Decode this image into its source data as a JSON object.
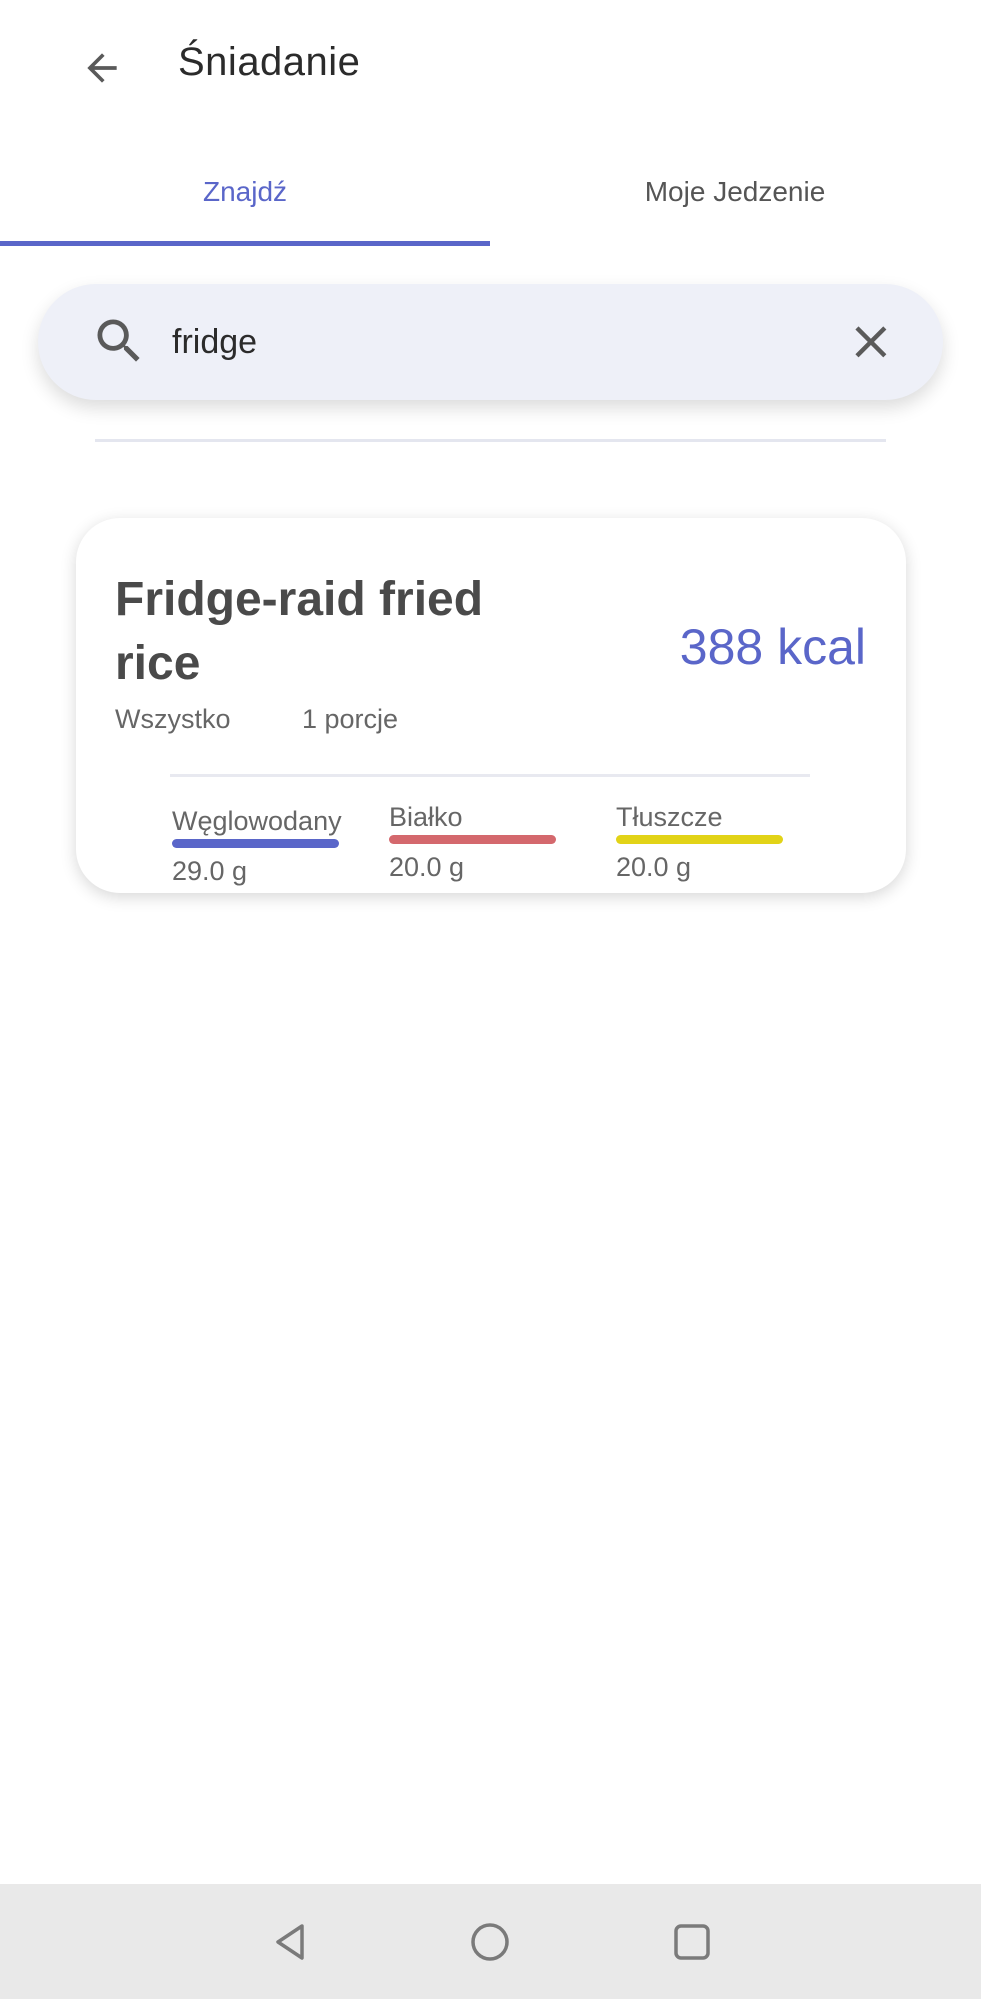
{
  "header": {
    "title": "Śniadanie",
    "back_icon": "arrow-left-icon"
  },
  "tabs": [
    {
      "label": "Znajdź",
      "active": true
    },
    {
      "label": "Moje Jedzenie",
      "active": false
    }
  ],
  "search": {
    "value": "fridge",
    "icon": "search-icon",
    "clear_icon": "close-icon"
  },
  "results": [
    {
      "name": "Fridge-raid fried rice",
      "kcal": "388 kcal",
      "category": "Wszystko",
      "portion": "1 porcje",
      "macros": [
        {
          "label": "Węglowodany",
          "value": "29.0 g",
          "color": "#5a66c9"
        },
        {
          "label": "Białko",
          "value": "20.0 g",
          "color": "#d4686d"
        },
        {
          "label": "Tłuszcze",
          "value": "20.0 g",
          "color": "#e2d317"
        }
      ]
    }
  ],
  "navbar": {
    "back_icon": "triangle-back-icon",
    "home_icon": "circle-home-icon",
    "recents_icon": "square-recents-icon"
  },
  "colors": {
    "accent": "#5a66c9",
    "search_bg": "#eef0f8",
    "navbar_bg": "#e9e9e9"
  }
}
